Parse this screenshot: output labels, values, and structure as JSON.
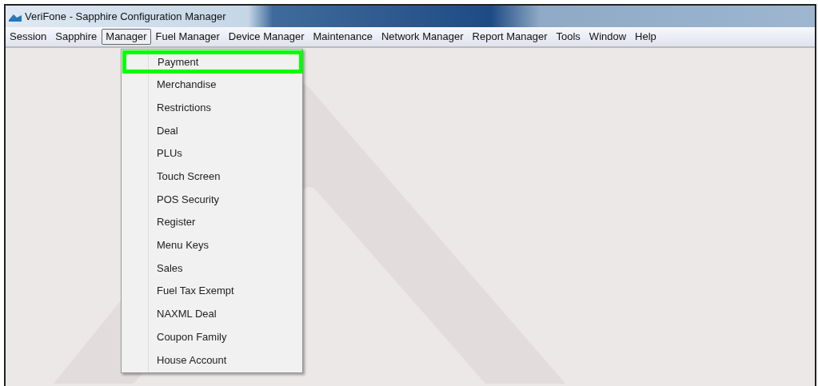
{
  "window": {
    "title": "VeriFone - Sapphire Configuration Manager"
  },
  "menu_bar": [
    {
      "label": "Session",
      "selected": false
    },
    {
      "label": "Sapphire",
      "selected": false
    },
    {
      "label": "Manager",
      "selected": true
    },
    {
      "label": "Fuel Manager",
      "selected": false
    },
    {
      "label": "Device Manager",
      "selected": false
    },
    {
      "label": "Maintenance",
      "selected": false
    },
    {
      "label": "Network Manager",
      "selected": false
    },
    {
      "label": "Report Manager",
      "selected": false
    },
    {
      "label": "Tools",
      "selected": false
    },
    {
      "label": "Window",
      "selected": false
    },
    {
      "label": "Help",
      "selected": false
    }
  ],
  "dropdown": {
    "items": [
      {
        "label": "Payment",
        "highlighted": true
      },
      {
        "label": "Merchandise",
        "highlighted": false
      },
      {
        "label": "Restrictions",
        "highlighted": false
      },
      {
        "label": "Deal",
        "highlighted": false
      },
      {
        "label": "PLUs",
        "highlighted": false
      },
      {
        "label": "Touch Screen",
        "highlighted": false
      },
      {
        "label": "POS Security",
        "highlighted": false
      },
      {
        "label": "Register",
        "highlighted": false
      },
      {
        "label": "Menu Keys",
        "highlighted": false
      },
      {
        "label": "Sales",
        "highlighted": false
      },
      {
        "label": "Fuel Tax Exempt",
        "highlighted": false
      },
      {
        "label": "NAXML Deal",
        "highlighted": false
      },
      {
        "label": "Coupon Family",
        "highlighted": false
      },
      {
        "label": "House Account",
        "highlighted": false
      }
    ]
  }
}
